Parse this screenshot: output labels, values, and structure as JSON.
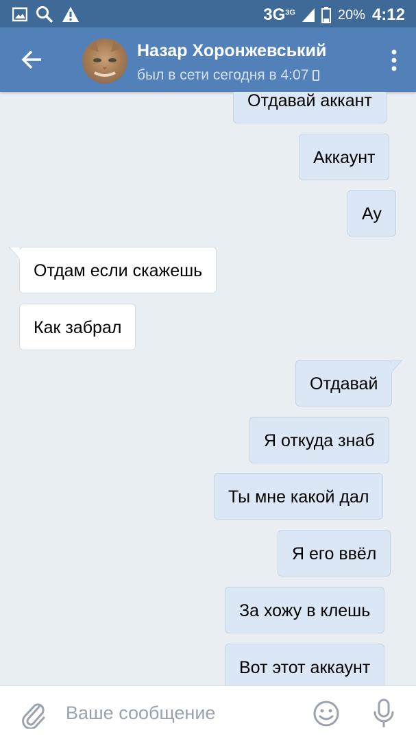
{
  "status_bar": {
    "network": "3G",
    "network_sup": "3G",
    "battery": "20%",
    "time": "4:12",
    "icons": [
      "image-icon",
      "search-icon",
      "warning-icon",
      "signal-icon",
      "battery-icon"
    ]
  },
  "header": {
    "contact_name": "Назар Хоронжевський",
    "last_seen": "был в сети сегодня в 4:07",
    "back_icon": "arrow-left-icon",
    "menu_icon": "more-vertical-icon"
  },
  "messages": [
    {
      "dir": "out",
      "text": "Отдавай аккант",
      "tail": false
    },
    {
      "dir": "out",
      "text": "Аккаунт",
      "tail": false
    },
    {
      "dir": "out",
      "text": "Ау",
      "tail": false
    },
    {
      "dir": "in",
      "text": "Отдам если скажешь",
      "tail": true
    },
    {
      "dir": "in",
      "text": "Как забрал",
      "tail": false
    },
    {
      "dir": "out",
      "text": "Отдавай",
      "tail": true
    },
    {
      "dir": "out",
      "text": "Я откуда знаб",
      "tail": false
    },
    {
      "dir": "out",
      "text": "Ты мне какой дал",
      "tail": false
    },
    {
      "dir": "out",
      "text": "Я его ввёл",
      "tail": false
    },
    {
      "dir": "out",
      "text": "За хожу в клешь",
      "tail": false
    },
    {
      "dir": "out",
      "text": "Вот этот аккаунт",
      "tail": false
    }
  ],
  "composer": {
    "placeholder": "Ваше сообщение",
    "attach_icon": "paperclip-icon",
    "emoji_icon": "smile-icon",
    "voice_icon": "microphone-icon"
  },
  "colors": {
    "header": "#5181b8",
    "status_bar": "#3f6a97",
    "background": "#e9eef3",
    "outgoing_bubble": "#dbe7f5",
    "incoming_bubble": "#ffffff"
  }
}
